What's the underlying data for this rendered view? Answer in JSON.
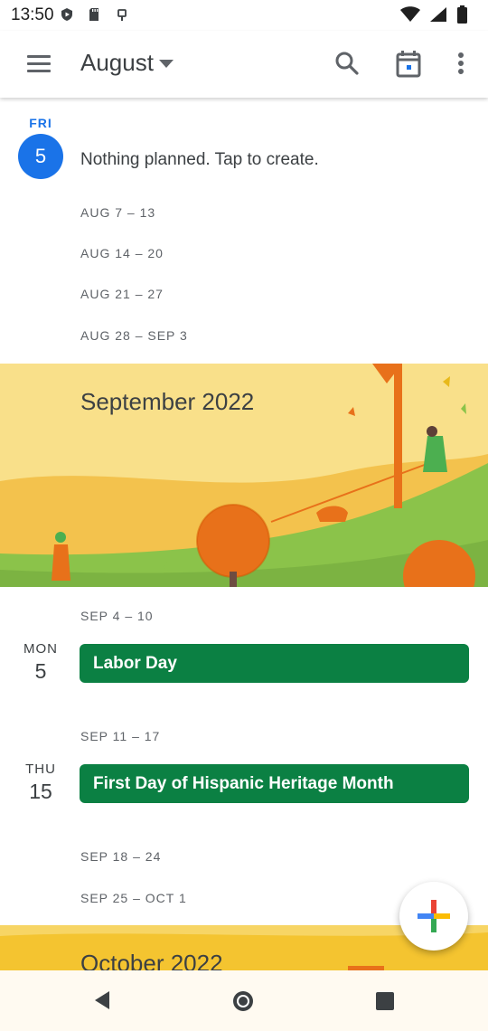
{
  "status_bar": {
    "time": "13:50",
    "left_icons": [
      "play-protect-icon",
      "sd-card-icon",
      "usb-icon"
    ],
    "right_icons": [
      "wifi-icon",
      "cell-signal-icon",
      "battery-icon"
    ]
  },
  "app_bar": {
    "month_label": "August",
    "actions": [
      "search-icon",
      "today-calendar-icon",
      "more-options-icon"
    ]
  },
  "today": {
    "day_name": "FRI",
    "day_number": "5",
    "empty_text": "Nothing planned. Tap to create."
  },
  "august_weeks": [
    "AUG 7 – 13",
    "AUG 14 – 20",
    "AUG 21 – 27",
    "AUG 28 – SEP 3"
  ],
  "september_banner": {
    "title": "September 2022"
  },
  "september_schedule": {
    "week1": "SEP 4 – 10",
    "day1": {
      "day_name": "MON",
      "day_number": "5",
      "event": "Labor Day"
    },
    "week2": "SEP 11 – 17",
    "day2": {
      "day_name": "THU",
      "day_number": "15",
      "event": "First Day of Hispanic Heritage Month"
    },
    "week3": "SEP 18 – 24",
    "week4": "SEP 25 – OCT 1"
  },
  "october_banner": {
    "title": "October 2022"
  },
  "fab": {
    "icon": "add-plus-icon"
  },
  "nav_bar": {
    "buttons": [
      "back-icon",
      "home-icon",
      "recents-icon"
    ]
  },
  "colors": {
    "accent": "#1a73e8",
    "event_green": "#0b8043",
    "banner_yellow": "#f8d46a",
    "hill_green": "#8bc34a"
  }
}
